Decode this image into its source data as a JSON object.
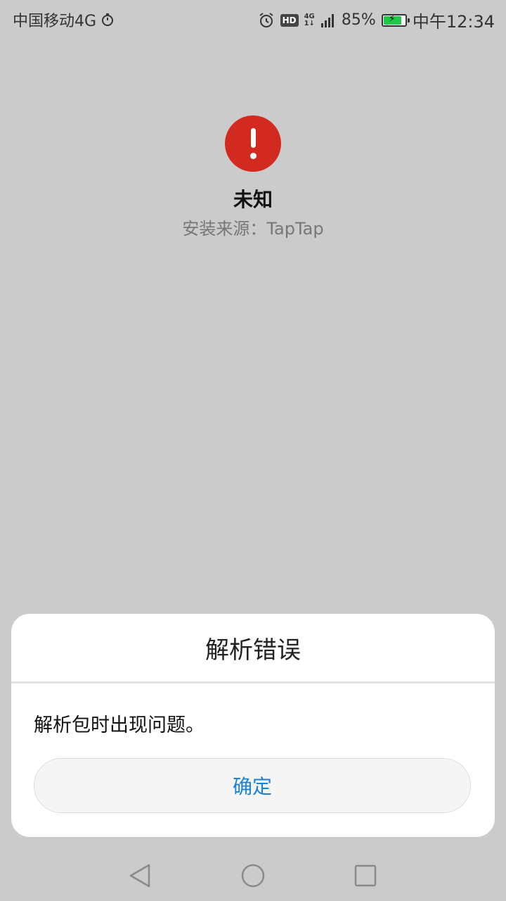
{
  "status_bar": {
    "carrier": "中国移动4G",
    "network": "4G",
    "network_sub": "1↓",
    "hd": "HD",
    "battery": "85%",
    "battery_level": 0.85,
    "battery_color": "#1ec94a",
    "time": "中午12:34",
    "icons": [
      "stopwatch-icon",
      "alarm-icon",
      "hd-icon",
      "signal-icon",
      "battery-icon"
    ]
  },
  "app": {
    "icon": "error-exclamation-icon",
    "icon_color": "#d32a1f",
    "name": "未知",
    "source": "安装来源：TapTap"
  },
  "dialog": {
    "title": "解析错误",
    "message": "解析包时出现问题。",
    "ok_label": "确定",
    "ok_color": "#1a82d8"
  },
  "nav": {
    "icons": [
      "back-icon",
      "home-icon",
      "recents-icon"
    ]
  }
}
